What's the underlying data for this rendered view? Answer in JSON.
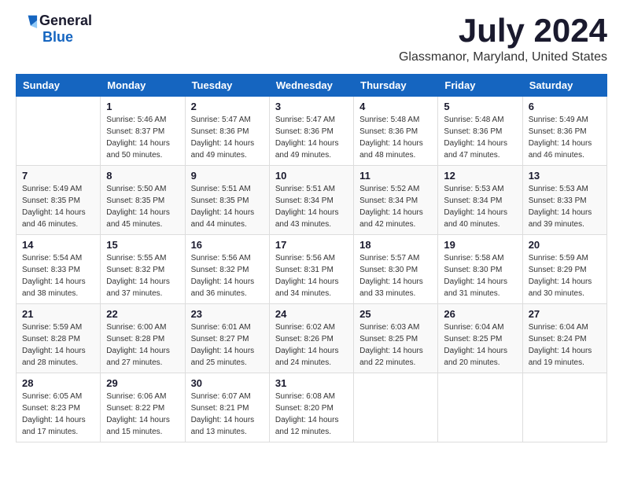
{
  "logo": {
    "general": "General",
    "blue": "Blue"
  },
  "title": "July 2024",
  "subtitle": "Glassmanor, Maryland, United States",
  "weekdays": [
    "Sunday",
    "Monday",
    "Tuesday",
    "Wednesday",
    "Thursday",
    "Friday",
    "Saturday"
  ],
  "weeks": [
    [
      {
        "day": "",
        "info": ""
      },
      {
        "day": "1",
        "info": "Sunrise: 5:46 AM\nSunset: 8:37 PM\nDaylight: 14 hours\nand 50 minutes."
      },
      {
        "day": "2",
        "info": "Sunrise: 5:47 AM\nSunset: 8:36 PM\nDaylight: 14 hours\nand 49 minutes."
      },
      {
        "day": "3",
        "info": "Sunrise: 5:47 AM\nSunset: 8:36 PM\nDaylight: 14 hours\nand 49 minutes."
      },
      {
        "day": "4",
        "info": "Sunrise: 5:48 AM\nSunset: 8:36 PM\nDaylight: 14 hours\nand 48 minutes."
      },
      {
        "day": "5",
        "info": "Sunrise: 5:48 AM\nSunset: 8:36 PM\nDaylight: 14 hours\nand 47 minutes."
      },
      {
        "day": "6",
        "info": "Sunrise: 5:49 AM\nSunset: 8:36 PM\nDaylight: 14 hours\nand 46 minutes."
      }
    ],
    [
      {
        "day": "7",
        "info": "Sunrise: 5:49 AM\nSunset: 8:35 PM\nDaylight: 14 hours\nand 46 minutes."
      },
      {
        "day": "8",
        "info": "Sunrise: 5:50 AM\nSunset: 8:35 PM\nDaylight: 14 hours\nand 45 minutes."
      },
      {
        "day": "9",
        "info": "Sunrise: 5:51 AM\nSunset: 8:35 PM\nDaylight: 14 hours\nand 44 minutes."
      },
      {
        "day": "10",
        "info": "Sunrise: 5:51 AM\nSunset: 8:34 PM\nDaylight: 14 hours\nand 43 minutes."
      },
      {
        "day": "11",
        "info": "Sunrise: 5:52 AM\nSunset: 8:34 PM\nDaylight: 14 hours\nand 42 minutes."
      },
      {
        "day": "12",
        "info": "Sunrise: 5:53 AM\nSunset: 8:34 PM\nDaylight: 14 hours\nand 40 minutes."
      },
      {
        "day": "13",
        "info": "Sunrise: 5:53 AM\nSunset: 8:33 PM\nDaylight: 14 hours\nand 39 minutes."
      }
    ],
    [
      {
        "day": "14",
        "info": "Sunrise: 5:54 AM\nSunset: 8:33 PM\nDaylight: 14 hours\nand 38 minutes."
      },
      {
        "day": "15",
        "info": "Sunrise: 5:55 AM\nSunset: 8:32 PM\nDaylight: 14 hours\nand 37 minutes."
      },
      {
        "day": "16",
        "info": "Sunrise: 5:56 AM\nSunset: 8:32 PM\nDaylight: 14 hours\nand 36 minutes."
      },
      {
        "day": "17",
        "info": "Sunrise: 5:56 AM\nSunset: 8:31 PM\nDaylight: 14 hours\nand 34 minutes."
      },
      {
        "day": "18",
        "info": "Sunrise: 5:57 AM\nSunset: 8:30 PM\nDaylight: 14 hours\nand 33 minutes."
      },
      {
        "day": "19",
        "info": "Sunrise: 5:58 AM\nSunset: 8:30 PM\nDaylight: 14 hours\nand 31 minutes."
      },
      {
        "day": "20",
        "info": "Sunrise: 5:59 AM\nSunset: 8:29 PM\nDaylight: 14 hours\nand 30 minutes."
      }
    ],
    [
      {
        "day": "21",
        "info": "Sunrise: 5:59 AM\nSunset: 8:28 PM\nDaylight: 14 hours\nand 28 minutes."
      },
      {
        "day": "22",
        "info": "Sunrise: 6:00 AM\nSunset: 8:28 PM\nDaylight: 14 hours\nand 27 minutes."
      },
      {
        "day": "23",
        "info": "Sunrise: 6:01 AM\nSunset: 8:27 PM\nDaylight: 14 hours\nand 25 minutes."
      },
      {
        "day": "24",
        "info": "Sunrise: 6:02 AM\nSunset: 8:26 PM\nDaylight: 14 hours\nand 24 minutes."
      },
      {
        "day": "25",
        "info": "Sunrise: 6:03 AM\nSunset: 8:25 PM\nDaylight: 14 hours\nand 22 minutes."
      },
      {
        "day": "26",
        "info": "Sunrise: 6:04 AM\nSunset: 8:25 PM\nDaylight: 14 hours\nand 20 minutes."
      },
      {
        "day": "27",
        "info": "Sunrise: 6:04 AM\nSunset: 8:24 PM\nDaylight: 14 hours\nand 19 minutes."
      }
    ],
    [
      {
        "day": "28",
        "info": "Sunrise: 6:05 AM\nSunset: 8:23 PM\nDaylight: 14 hours\nand 17 minutes."
      },
      {
        "day": "29",
        "info": "Sunrise: 6:06 AM\nSunset: 8:22 PM\nDaylight: 14 hours\nand 15 minutes."
      },
      {
        "day": "30",
        "info": "Sunrise: 6:07 AM\nSunset: 8:21 PM\nDaylight: 14 hours\nand 13 minutes."
      },
      {
        "day": "31",
        "info": "Sunrise: 6:08 AM\nSunset: 8:20 PM\nDaylight: 14 hours\nand 12 minutes."
      },
      {
        "day": "",
        "info": ""
      },
      {
        "day": "",
        "info": ""
      },
      {
        "day": "",
        "info": ""
      }
    ]
  ]
}
